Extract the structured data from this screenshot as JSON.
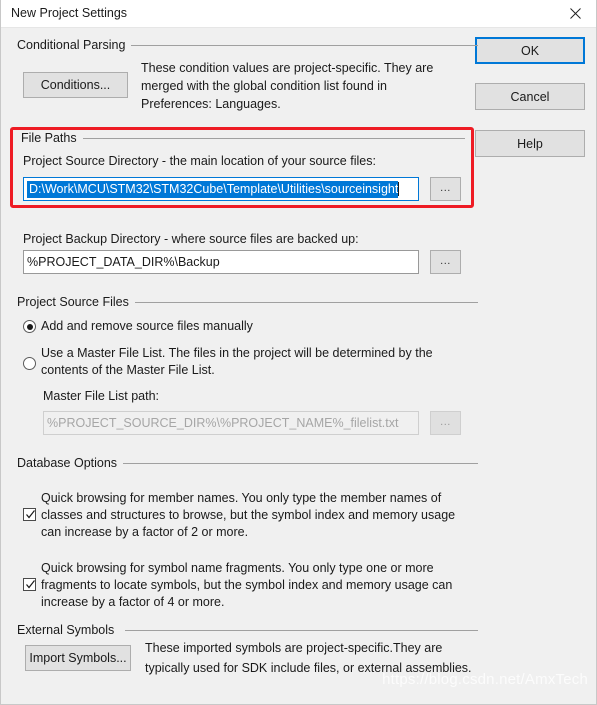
{
  "window": {
    "title": "New Project Settings",
    "close_icon": "close-icon"
  },
  "buttons": {
    "ok": "OK",
    "cancel": "Cancel",
    "help": "Help"
  },
  "conditional_parsing": {
    "group_label": "Conditional Parsing",
    "conditions_button": "Conditions...",
    "description_line1": "These condition values are project-specific.  They are",
    "description_line2": "merged with the global condition list found in",
    "description_line3": "Preferences: Languages."
  },
  "file_paths": {
    "group_label": "File Paths",
    "source_dir_label": "Project Source Directory - the main location of your source files:",
    "source_dir_value": "D:\\Work\\MCU\\STM32\\STM32Cube\\Template\\Utilities\\sourceinsight",
    "source_dir_browse": "...",
    "backup_dir_label": "Project Backup Directory - where source files are backed up:",
    "backup_dir_value": "%PROJECT_DATA_DIR%\\Backup",
    "backup_dir_browse": "..."
  },
  "project_source_files": {
    "group_label": "Project Source Files",
    "radio_manual": "Add and remove source files manually",
    "radio_master_line1": "Use a Master File List. The files in the project will be determined by the",
    "radio_master_line2": "contents of the Master File List.",
    "master_path_label": "Master File List path:",
    "master_path_value": "%PROJECT_SOURCE_DIR%\\%PROJECT_NAME%_filelist.txt",
    "master_path_browse": "..."
  },
  "database_options": {
    "group_label": "Database Options",
    "option1_line1": "Quick browsing for member names.  You only type the member names of",
    "option1_line2": "classes and structures to browse, but the symbol index and memory usage",
    "option1_line3": "can increase by a factor of 2 or more.",
    "option2_line1": "Quick browsing for symbol name fragments.  You only type one or more",
    "option2_line2": "fragments to locate symbols, but the symbol index and memory usage can",
    "option2_line3": "increase by a factor of 4 or more."
  },
  "external_symbols": {
    "group_label": "External Symbols",
    "import_button": "Import Symbols...",
    "description_line1": "These imported symbols are project-specific.They are",
    "description_line2": "typically used for SDK include files, or external assemblies."
  },
  "watermark": {
    "text": "https://blog.csdn.net/AmxTech"
  },
  "colors": {
    "accent": "#0078d7",
    "annotation": "#ee1b24",
    "dialog_bg": "#f0f0f0"
  }
}
